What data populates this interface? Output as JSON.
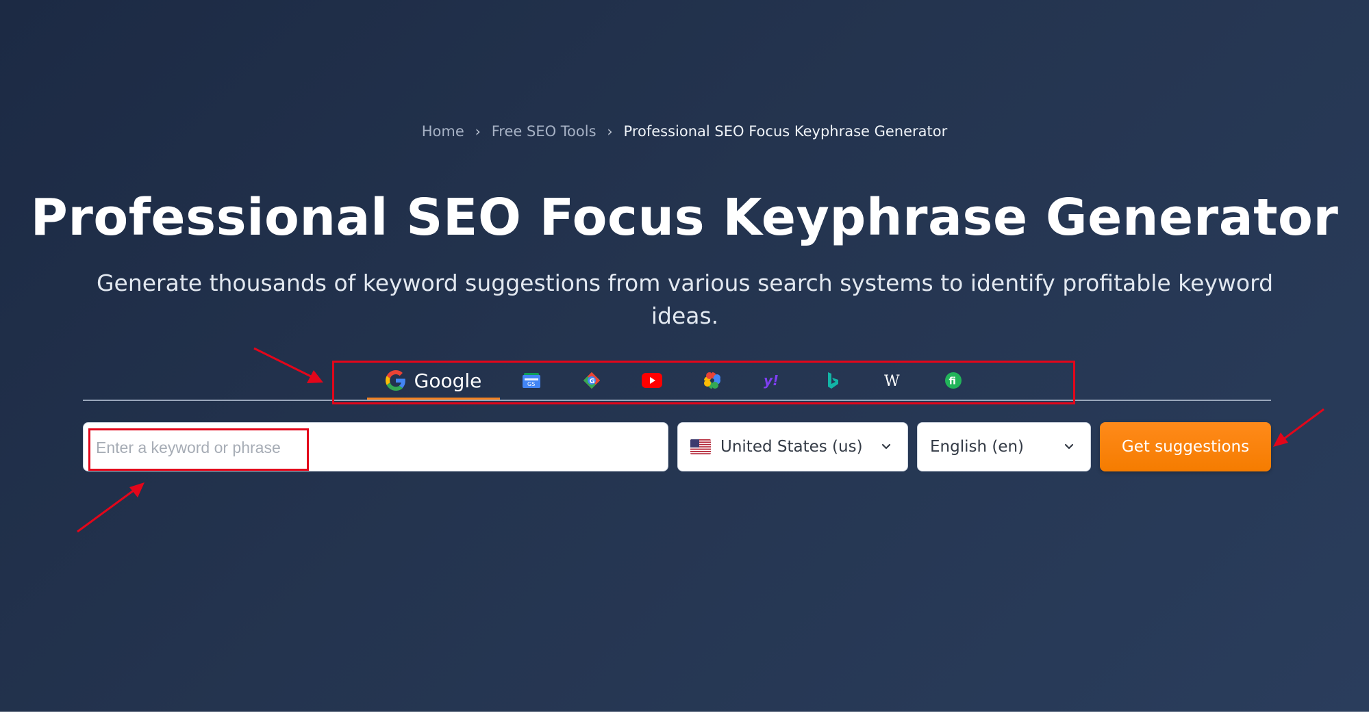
{
  "breadcrumb": {
    "items": [
      "Home",
      "Free SEO Tools",
      "Professional SEO Focus Keyphrase Generator"
    ],
    "separator": "›"
  },
  "page_title": "Professional SEO Focus Keyphrase Generator",
  "subtitle": "Generate thousands of keyword suggestions from various search systems to identify profitable keyword ideas.",
  "tabs": [
    {
      "name": "google",
      "label": "Google",
      "icon": "google-icon",
      "active": true
    },
    {
      "name": "google-news",
      "icon": "google-news-icon"
    },
    {
      "name": "google-shopping",
      "icon": "google-shopping-icon"
    },
    {
      "name": "youtube",
      "icon": "youtube-icon"
    },
    {
      "name": "google-photos",
      "icon": "pinwheel-icon"
    },
    {
      "name": "yahoo",
      "icon": "yahoo-icon"
    },
    {
      "name": "bing",
      "icon": "bing-icon"
    },
    {
      "name": "wikipedia",
      "icon": "wikipedia-icon"
    },
    {
      "name": "fi",
      "icon": "fi-icon"
    }
  ],
  "search": {
    "placeholder": "Enter a keyword or phrase",
    "value": ""
  },
  "country_select": {
    "value": "United States (us)",
    "icon": "us-flag-icon"
  },
  "language_select": {
    "value": "English (en)"
  },
  "submit_label": "Get suggestions",
  "colors": {
    "background": "#1e2c46",
    "accent": "#f58220",
    "annotation": "#e3061a"
  }
}
